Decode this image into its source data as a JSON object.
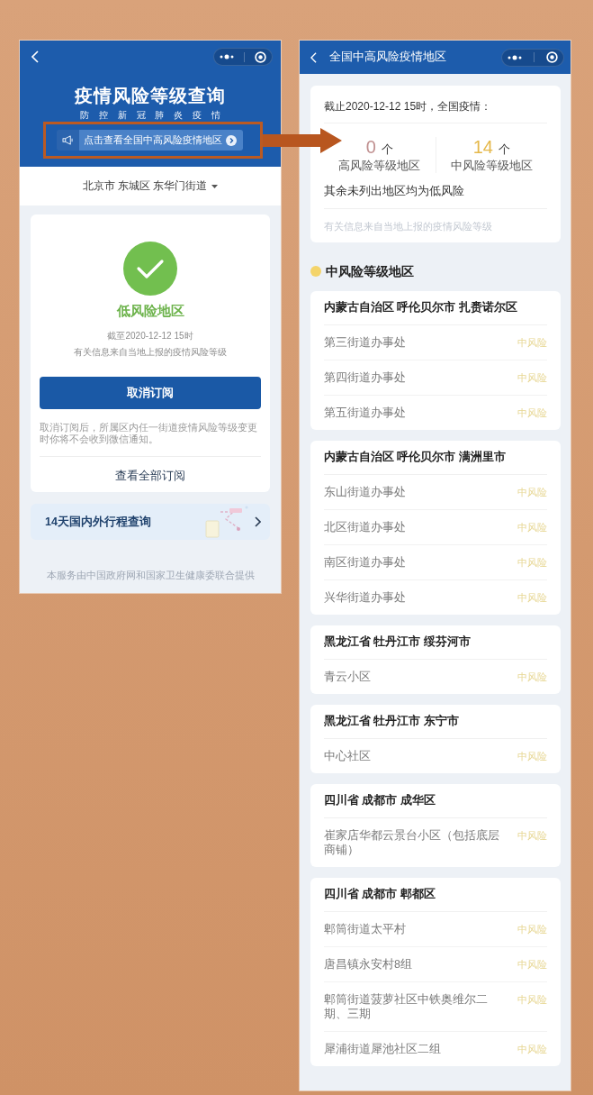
{
  "left_screen": {
    "header": {
      "title": "疫情风险等级查询",
      "subtitle": "防 控 新 冠 肺 炎 疫 情",
      "banner": "点击查看全国中高风险疫情地区"
    },
    "location": "北京市 东城区 东华门街道",
    "status_card": {
      "risk_level": "低风险地区",
      "updated": "截至2020-12-12 15时",
      "source": "有关信息来自当地上报的疫情风险等级",
      "button": "取消订阅",
      "note": "取消订阅后，所属区内任一街道疫情风险等级变更时你将不会收到微信通知。",
      "link": "查看全部订阅"
    },
    "travel_card": {
      "label": "14天国内外行程查询"
    },
    "footer": "本服务由中国政府网和国家卫生健康委联合提供"
  },
  "right_screen": {
    "title": "全国中高风险疫情地区",
    "summary": {
      "as_of": "截止2020-12-12 15时，全国疫情：",
      "stats": [
        {
          "count": "0",
          "unit": "个",
          "label": "高风险等级地区",
          "color": "#c09090"
        },
        {
          "count": "14",
          "unit": "个",
          "label": "中风险等级地区",
          "color": "#e5b84a"
        }
      ],
      "note": "其余未列出地区均为低风险",
      "source": "有关信息来自当地上报的疫情风险等级"
    },
    "section_title": "中风险等级地区",
    "groups": [
      {
        "region": "内蒙古自治区 呼伦贝尔市 扎赉诺尔区",
        "areas": [
          {
            "name": "第三街道办事处",
            "risk": "中风险"
          },
          {
            "name": "第四街道办事处",
            "risk": "中风险"
          },
          {
            "name": "第五街道办事处",
            "risk": "中风险"
          }
        ]
      },
      {
        "region": "内蒙古自治区 呼伦贝尔市 满洲里市",
        "areas": [
          {
            "name": "东山街道办事处",
            "risk": "中风险"
          },
          {
            "name": "北区街道办事处",
            "risk": "中风险"
          },
          {
            "name": "南区街道办事处",
            "risk": "中风险"
          },
          {
            "name": "兴华街道办事处",
            "risk": "中风险"
          }
        ]
      },
      {
        "region": "黑龙江省 牡丹江市 绥芬河市",
        "areas": [
          {
            "name": "青云小区",
            "risk": "中风险"
          }
        ]
      },
      {
        "region": "黑龙江省 牡丹江市 东宁市",
        "areas": [
          {
            "name": "中心社区",
            "risk": "中风险"
          }
        ]
      },
      {
        "region": "四川省 成都市 成华区",
        "areas": [
          {
            "name": "崔家店华都云景台小区（包括底层商铺）",
            "risk": "中风险"
          }
        ]
      },
      {
        "region": "四川省 成都市 郫都区",
        "areas": [
          {
            "name": "郫筒街道太平村",
            "risk": "中风险"
          },
          {
            "name": "唐昌镇永安村8组",
            "risk": "中风险"
          },
          {
            "name": "郫筒街道菠萝社区中铁奥维尔二期、三期",
            "risk": "中风险"
          },
          {
            "name": "犀浦街道犀池社区二组",
            "risk": "中风险"
          }
        ]
      }
    ]
  }
}
